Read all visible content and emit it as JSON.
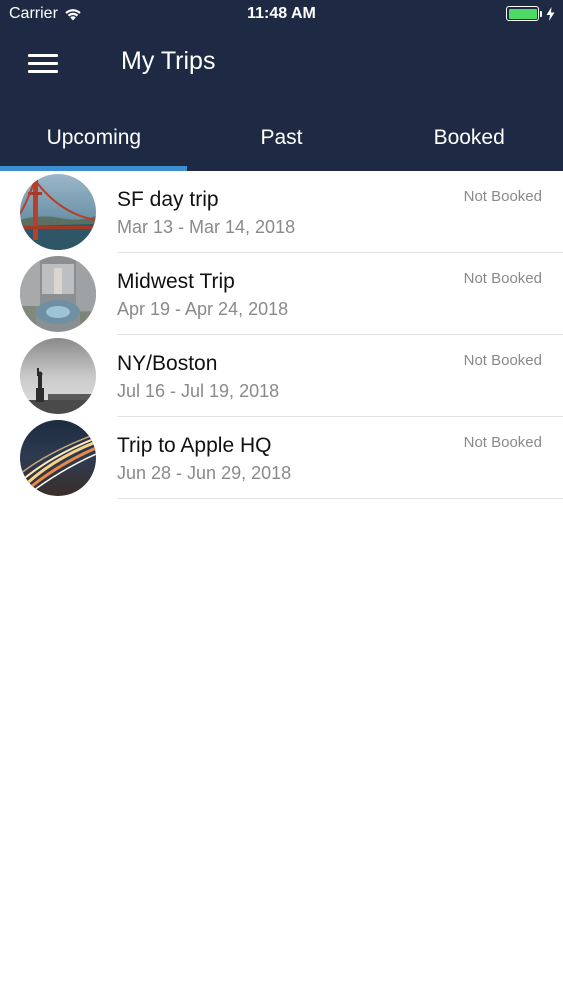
{
  "status_bar": {
    "carrier": "Carrier",
    "time": "11:48 AM",
    "battery_level": 1.0,
    "battery_color": "#4cd964"
  },
  "nav": {
    "menu_icon": "hamburger-menu-icon",
    "title": "My Trips"
  },
  "tabs": [
    {
      "label": "Upcoming",
      "selected": true
    },
    {
      "label": "Past",
      "selected": false
    },
    {
      "label": "Booked",
      "selected": false
    }
  ],
  "colors": {
    "header_bg": "#1e2a44",
    "tab_indicator": "#3b8fd1"
  },
  "trips": [
    {
      "name": "SF day trip",
      "dates": "Mar 13 - Mar 14, 2018",
      "status": "Not Booked",
      "thumbnail": "golden-gate-bridge-photo"
    },
    {
      "name": "Midwest Trip",
      "dates": "Apr 19 - Apr 24, 2018",
      "status": "Not Booked",
      "thumbnail": "city-plaza-aerial-photo"
    },
    {
      "name": "NY/Boston",
      "dates": "Jul 16 - Jul 19, 2018",
      "status": "Not Booked",
      "thumbnail": "statue-of-liberty-photo"
    },
    {
      "name": "Trip to Apple HQ",
      "dates": "Jun 28 - Jun 29, 2018",
      "status": "Not Booked",
      "thumbnail": "highway-light-trails-photo"
    }
  ]
}
